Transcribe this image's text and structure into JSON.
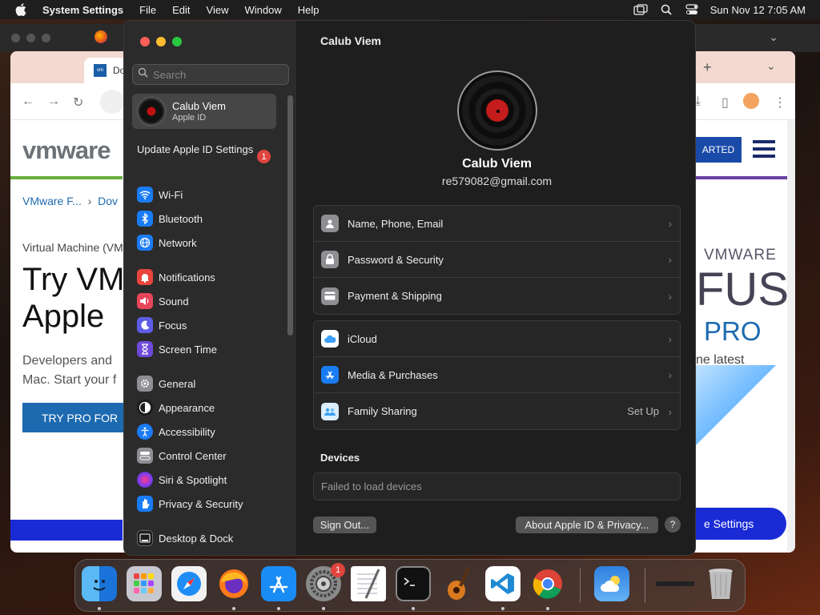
{
  "menubar": {
    "app_name": "System Settings",
    "menus": [
      "File",
      "Edit",
      "View",
      "Window",
      "Help"
    ],
    "datetime": "Sun Nov 12  7:05 AM"
  },
  "browser": {
    "tab_title": "Do",
    "logo": "vmware",
    "breadcrumb_1": "VMware F...",
    "breadcrumb_2": "Dov",
    "vm_label": "Virtual Machine (VM",
    "hero_line1": "Try VM",
    "hero_line2": "Apple",
    "hero_sub_1": "Developers and",
    "hero_sub_2": "Mac. Start your f",
    "try_button": "TRY PRO FOR",
    "started_button": "ARTED",
    "promo_vmware": "VMWARE",
    "promo_fus": "FUS",
    "promo_pro": "PRO",
    "promo_latest": "ne latest",
    "settings_button": "e Settings"
  },
  "settings": {
    "search_placeholder": "Search",
    "account": {
      "name": "Calub Viem",
      "subtitle": "Apple ID"
    },
    "update_notice": "Update Apple ID Settings",
    "update_badge": "1",
    "sidebar_items": [
      {
        "label": "Wi-Fi",
        "icon": "wifi-icon",
        "color": "#1a7cf5"
      },
      {
        "label": "Bluetooth",
        "icon": "bluetooth-icon",
        "color": "#1a7cf5"
      },
      {
        "label": "Network",
        "icon": "globe-icon",
        "color": "#1a7cf5"
      },
      {
        "label": "Notifications",
        "icon": "bell-icon",
        "color": "#e8453c"
      },
      {
        "label": "Sound",
        "icon": "speaker-icon",
        "color": "#e8455a"
      },
      {
        "label": "Focus",
        "icon": "moon-icon",
        "color": "#5e5ce6"
      },
      {
        "label": "Screen Time",
        "icon": "hourglass-icon",
        "color": "#6e4ad8"
      },
      {
        "label": "General",
        "icon": "gear-icon",
        "color": "#8e8e93"
      },
      {
        "label": "Appearance",
        "icon": "appearance-icon",
        "color": "#1c1c1e"
      },
      {
        "label": "Accessibility",
        "icon": "accessibility-icon",
        "color": "#1a7cf5"
      },
      {
        "label": "Control Center",
        "icon": "control-center-icon",
        "color": "#8e8e93"
      },
      {
        "label": "Siri & Spotlight",
        "icon": "siri-icon",
        "color": "#b03cd8"
      },
      {
        "label": "Privacy & Security",
        "icon": "hand-icon",
        "color": "#1a7cf5"
      },
      {
        "label": "Desktop & Dock",
        "icon": "dock-icon",
        "color": "#1c1c1e"
      }
    ],
    "page_title": "Calub Viem",
    "profile_name": "Calub Viem",
    "profile_email": "re579082@gmail.com",
    "group1": [
      {
        "label": "Name, Phone, Email",
        "icon": "id-card-icon"
      },
      {
        "label": "Password & Security",
        "icon": "lock-icon"
      },
      {
        "label": "Payment & Shipping",
        "icon": "credit-card-icon"
      }
    ],
    "group2": [
      {
        "label": "iCloud",
        "icon": "icloud-icon"
      },
      {
        "label": "Media & Purchases",
        "icon": "app-store-icon"
      },
      {
        "label": "Family Sharing",
        "icon": "family-icon",
        "value": "Set Up"
      }
    ],
    "devices_heading": "Devices",
    "devices_message": "Failed to load devices",
    "sign_out": "Sign Out...",
    "about": "About Apple ID & Privacy...",
    "help": "?"
  },
  "dock": {
    "apps": [
      "Finder",
      "Launchpad",
      "Safari",
      "Firefox",
      "App Store",
      "System Settings",
      "TextEdit",
      "Terminal",
      "GarageBand",
      "Visual Studio Code",
      "Google Chrome",
      "Weather",
      "Trash"
    ],
    "settings_badge": "1"
  }
}
